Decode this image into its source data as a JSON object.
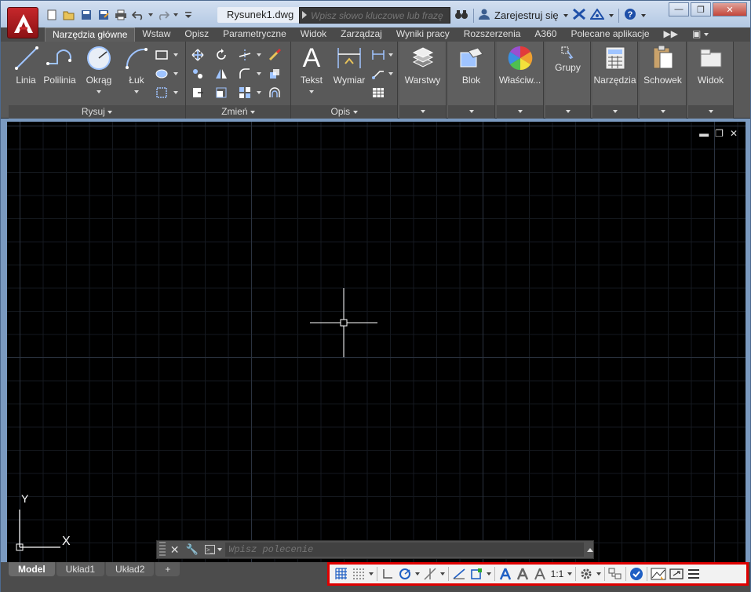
{
  "window": {
    "file_title": "Rysunek1.dwg",
    "search_placeholder": "Wpisz słowo kluczowe lub frazę",
    "signin_label": "Zarejestruj się"
  },
  "tabs": [
    {
      "label": "Narzędzia główne",
      "active": true
    },
    {
      "label": "Wstaw"
    },
    {
      "label": "Opisz"
    },
    {
      "label": "Parametryczne"
    },
    {
      "label": "Widok"
    },
    {
      "label": "Zarządzaj"
    },
    {
      "label": "Wyniki pracy"
    },
    {
      "label": "Rozszerzenia"
    },
    {
      "label": "A360"
    },
    {
      "label": "Polecane aplikacje"
    }
  ],
  "ribbon": {
    "draw": {
      "title": "Rysuj",
      "line": "Linia",
      "polyline": "Polilinia",
      "circle": "Okrąg",
      "arc": "Łuk"
    },
    "modify": {
      "title": "Zmień"
    },
    "annotation": {
      "title": "Opis",
      "text": "Tekst",
      "dimension": "Wymiar",
      "text_glyph": "A"
    },
    "layers": "Warstwy",
    "block": "Blok",
    "properties": "Właściw...",
    "groups": "Grupy",
    "utilities": "Narzędzia",
    "clipboard": "Schowek",
    "view": "Widok"
  },
  "canvas": {
    "ucs_y": "Y",
    "ucs_x": "X",
    "command_placeholder": "Wpisz polecenie"
  },
  "layout_tabs": [
    "Model",
    "Układ1",
    "Układ2"
  ],
  "add_layout": "+",
  "status": {
    "scale": "1:1"
  }
}
